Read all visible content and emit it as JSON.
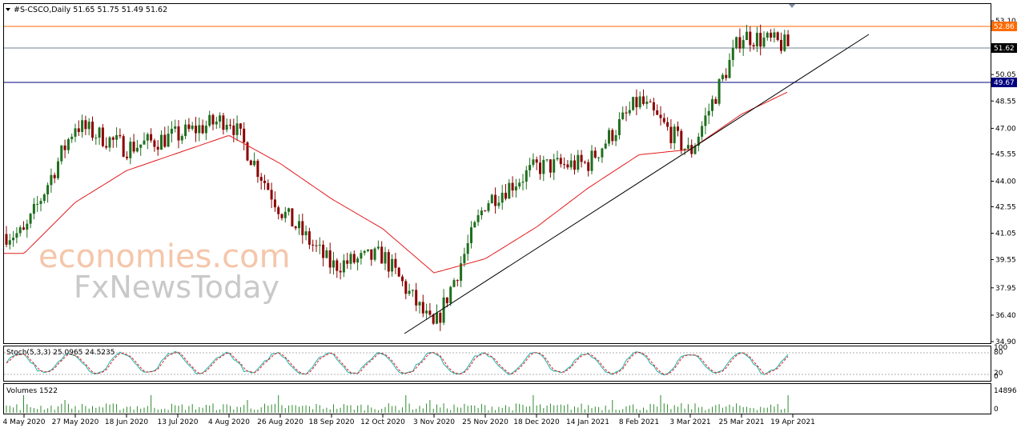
{
  "header": {
    "symbol_line": "#S-CSCO,Daily  51.65 51.75 51.49 51.62"
  },
  "watermark": {
    "line1": "economies.com",
    "line2": "FxNewsToday"
  },
  "price_panel": {
    "price_ticks": [
      "53.10",
      "51.62",
      "50.05",
      "48.55",
      "47.00",
      "45.55",
      "44.00",
      "42.55",
      "41.05",
      "39.55",
      "37.95",
      "36.40",
      "34.90"
    ],
    "current_price_tag": "51.62",
    "resistance_tag": "52.86",
    "support_tag": "49.67",
    "colors": {
      "bull": "#1f6f1f",
      "bear": "#8b0000",
      "ma": "#e41a1c",
      "resistance_line": "#ff6a00",
      "support_line": "#000080",
      "current_line": "#708090"
    }
  },
  "stoch_panel": {
    "label": "Stoch(5,3,3) 25.0965 24.5235",
    "ticks": [
      "100",
      "80",
      "20",
      "0"
    ],
    "colors": {
      "main": "#20b2aa",
      "signal": "#e41a1c"
    }
  },
  "volume_panel": {
    "label": "Volumes 1522",
    "ticks": [
      "14896",
      "0"
    ],
    "color": "#2e8b2e"
  },
  "x_axis": {
    "labels": [
      "4 May 2020",
      "27 May 2020",
      "18 Jun 2020",
      "13 Jul 2020",
      "4 Aug 2020",
      "26 Aug 2020",
      "18 Sep 2020",
      "12 Oct 2020",
      "3 Nov 2020",
      "25 Nov 2020",
      "18 Dec 2020",
      "14 Jan 2021",
      "8 Feb 2021",
      "3 Mar 2021",
      "25 Mar 2021",
      "19 Apr 2021"
    ]
  },
  "chart_data": {
    "type": "candlestick",
    "symbol": "#S-CSCO",
    "timeframe": "Daily",
    "ohlc_last": {
      "open": 51.65,
      "high": 51.75,
      "low": 51.49,
      "close": 51.62
    },
    "ylim": [
      34.9,
      53.1
    ],
    "horizontal_levels": [
      52.86,
      51.62,
      49.67
    ],
    "trendline": {
      "from": {
        "date": "3 Nov 2020",
        "price": 35.2
      },
      "to": {
        "date": "after 19 Apr 2021",
        "price": 52.6
      }
    },
    "moving_average_anchor_points": [
      {
        "date": "4 May 2020",
        "value": 39.9
      },
      {
        "date": "27 May 2020",
        "value": 42.8
      },
      {
        "date": "18 Jun 2020",
        "value": 44.6
      },
      {
        "date": "13 Jul 2020",
        "value": 45.6
      },
      {
        "date": "4 Aug 2020",
        "value": 46.6
      },
      {
        "date": "26 Aug 2020",
        "value": 45.0
      },
      {
        "date": "18 Sep 2020",
        "value": 43.0
      },
      {
        "date": "12 Oct 2020",
        "value": 41.3
      },
      {
        "date": "3 Nov 2020",
        "value": 38.8
      },
      {
        "date": "25 Nov 2020",
        "value": 39.6
      },
      {
        "date": "18 Dec 2020",
        "value": 41.4
      },
      {
        "date": "14 Jan 2021",
        "value": 43.6
      },
      {
        "date": "8 Feb 2021",
        "value": 45.5
      },
      {
        "date": "3 Mar 2021",
        "value": 45.8
      },
      {
        "date": "25 Mar 2021",
        "value": 47.8
      },
      {
        "date": "19 Apr 2021",
        "value": 49.2
      }
    ],
    "close_anchor_points": [
      {
        "date": "4 May 2020",
        "close": 41.0
      },
      {
        "date": "27 May 2020",
        "close": 47.2
      },
      {
        "date": "18 Jun 2020",
        "close": 45.9
      },
      {
        "date": "13 Jul 2020",
        "close": 46.6
      },
      {
        "date": "4 Aug 2020",
        "close": 47.6
      },
      {
        "date": "26 Aug 2020",
        "close": 42.4
      },
      {
        "date": "18 Sep 2020",
        "close": 39.2
      },
      {
        "date": "12 Oct 2020",
        "close": 39.8
      },
      {
        "date": "3 Nov 2020",
        "close": 35.6
      },
      {
        "date": "25 Nov 2020",
        "close": 42.8
      },
      {
        "date": "18 Dec 2020",
        "close": 44.8
      },
      {
        "date": "14 Jan 2021",
        "close": 45.0
      },
      {
        "date": "8 Feb 2021",
        "close": 48.6
      },
      {
        "date": "3 Mar 2021",
        "close": 45.6
      },
      {
        "date": "25 Mar 2021",
        "close": 52.3
      },
      {
        "date": "19 Apr 2021",
        "close": 51.62
      }
    ],
    "stochastic": {
      "k": 25.0965,
      "d": 24.5235,
      "levels": [
        80,
        20
      ],
      "range": [
        0,
        100
      ]
    },
    "volume": {
      "last": 1522,
      "max": 14896
    }
  }
}
